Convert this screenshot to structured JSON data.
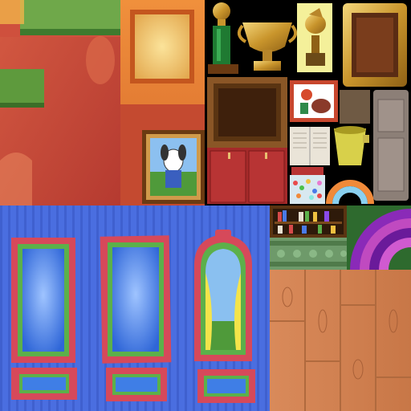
{
  "atlas": {
    "kind": "game-texture-atlas",
    "regions": [
      {
        "name": "red-wall-with-shelves",
        "colors": {
          "wall": "#c8473a",
          "shelf": "#5e9a3d"
        }
      },
      {
        "name": "orange-wall-with-window",
        "colors": {
          "wall": "#e57c32",
          "window": "#f2c86a"
        }
      },
      {
        "name": "framed-dog-portrait"
      },
      {
        "name": "green-trophy"
      },
      {
        "name": "gold-cup-trophy"
      },
      {
        "name": "bird-statue-plaque"
      },
      {
        "name": "ornate-gold-frame"
      },
      {
        "name": "dark-wood-frame"
      },
      {
        "name": "character-art-frame"
      },
      {
        "name": "red-cabinet-doors"
      },
      {
        "name": "open-book"
      },
      {
        "name": "green-bucket"
      },
      {
        "name": "grey-door"
      },
      {
        "name": "jar-of-candy"
      },
      {
        "name": "rainbow-arch"
      },
      {
        "name": "blue-striped-wall-with-windows",
        "colors": {
          "wall": "#4b6fe0",
          "frame": "#d6495a",
          "glass": "#3f7ee6"
        }
      },
      {
        "name": "bookshelf"
      },
      {
        "name": "carved-molding"
      },
      {
        "name": "purple-rug-arcs"
      },
      {
        "name": "wood-floor-planks",
        "colors": {
          "wood": "#d9895a"
        }
      }
    ]
  },
  "picture_captions": {
    "dog_portrait": "",
    "book_text": ""
  }
}
